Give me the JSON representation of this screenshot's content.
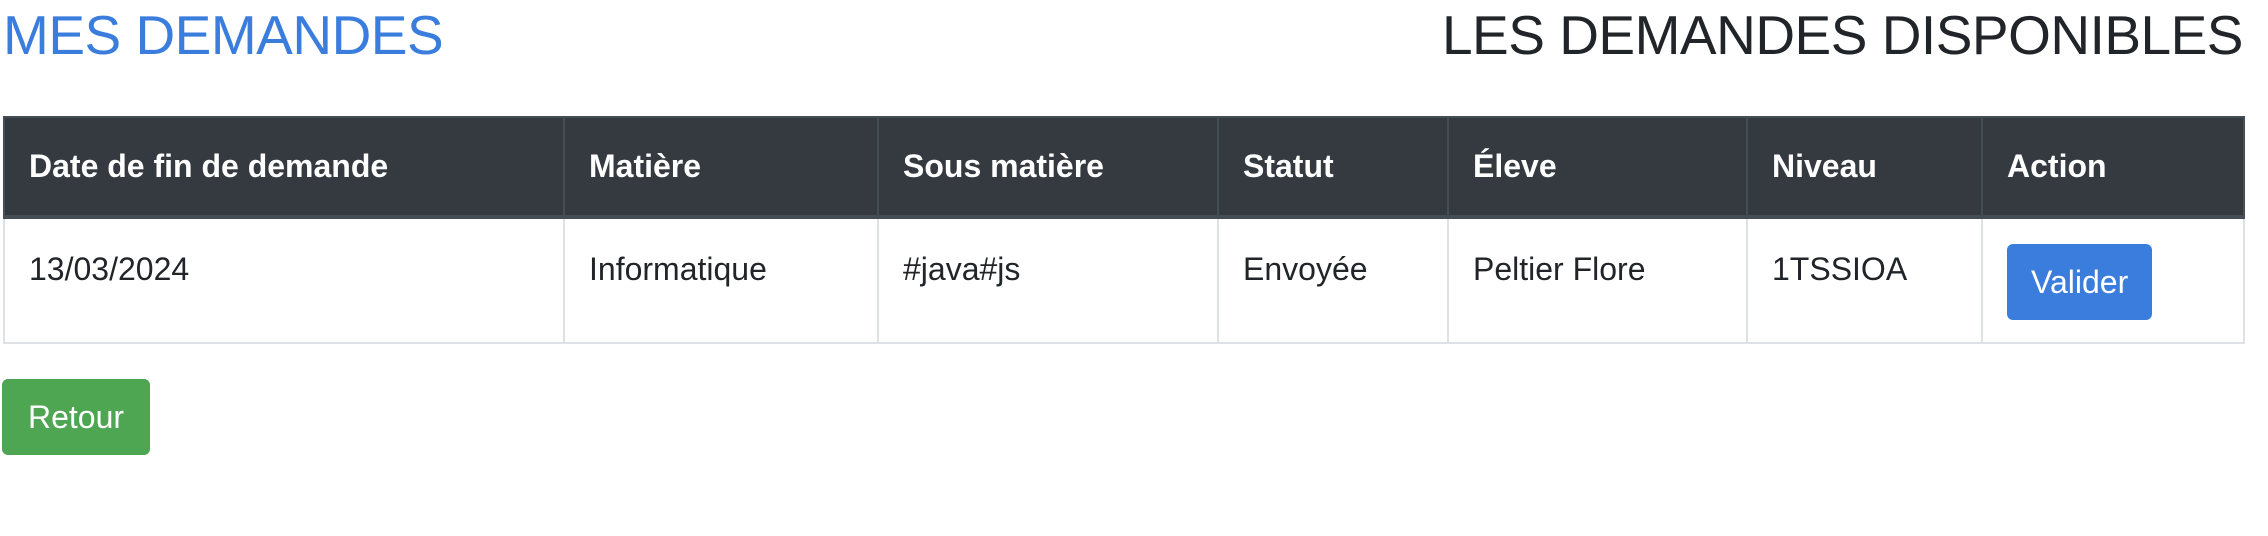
{
  "header": {
    "my_requests_link": "MES DEMANDES",
    "available_requests_title": "LES DEMANDES DISPONIBLES"
  },
  "table": {
    "columns": [
      "Date de fin de demande",
      "Matière",
      "Sous matière",
      "Statut",
      "Éleve",
      "Niveau",
      "Action"
    ],
    "rows": [
      {
        "date": "13/03/2024",
        "subject": "Informatique",
        "subsubject": "#java#js",
        "status": "Envoyée",
        "student": "Peltier Flore",
        "level": "1TSSIOA",
        "action_label": "Valider"
      }
    ]
  },
  "footer": {
    "back_label": "Retour"
  },
  "colors": {
    "link_blue": "#3b7ddd",
    "header_dark": "#343a40",
    "button_primary": "#3b7ddd",
    "button_success": "#4ea552"
  }
}
